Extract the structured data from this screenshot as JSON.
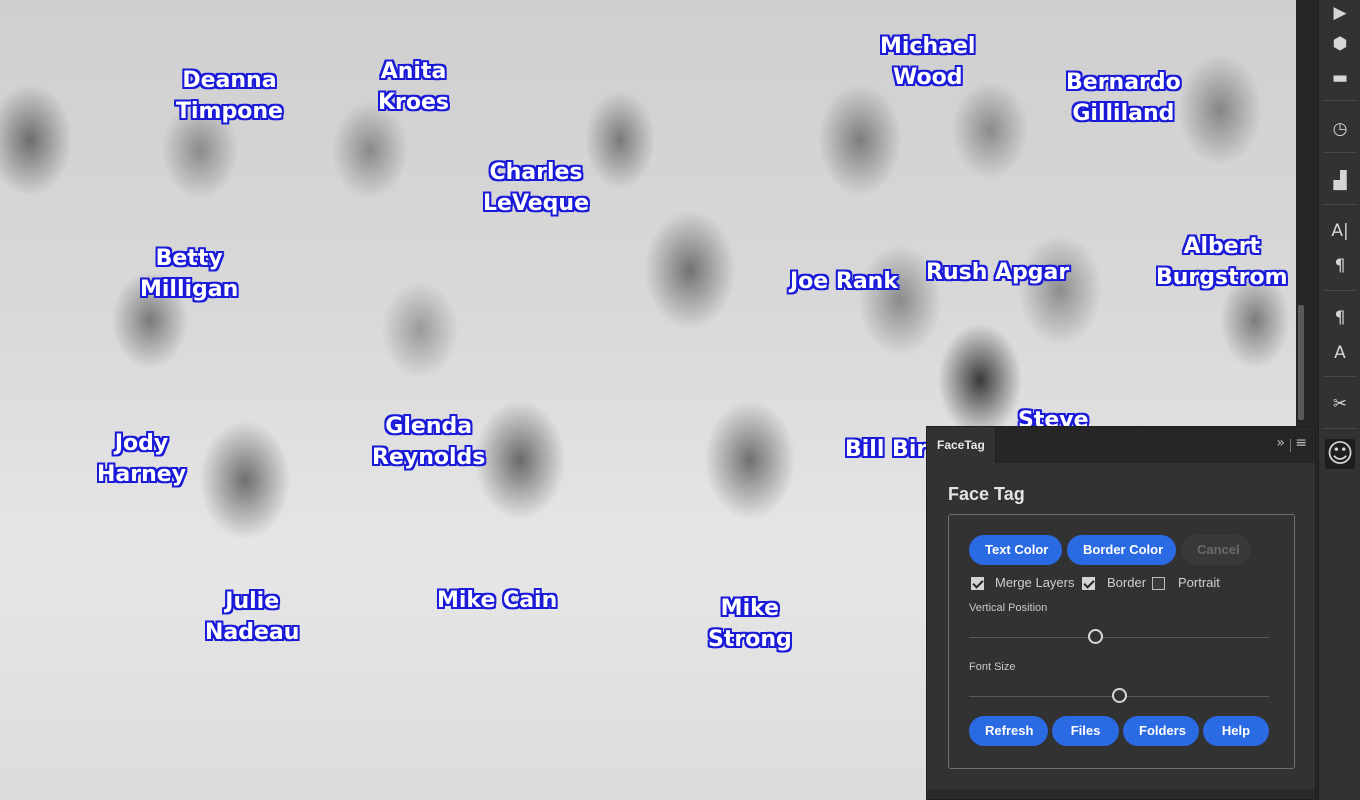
{
  "photo": {
    "tags": [
      {
        "id": "deanna",
        "lines": [
          "Deanna",
          "Timpone"
        ]
      },
      {
        "id": "anita",
        "lines": [
          "Anita",
          "Kroes"
        ]
      },
      {
        "id": "charles",
        "lines": [
          "Charles",
          "LeVeque"
        ]
      },
      {
        "id": "michael",
        "lines": [
          "Michael",
          "Wood"
        ]
      },
      {
        "id": "bernardo",
        "lines": [
          "Bernardo",
          "Gilliland"
        ]
      },
      {
        "id": "betty",
        "lines": [
          "Betty",
          "Milligan"
        ]
      },
      {
        "id": "joe",
        "lines": [
          "Joe Rank"
        ]
      },
      {
        "id": "rush",
        "lines": [
          "Rush Apgar"
        ]
      },
      {
        "id": "albert",
        "lines": [
          "Albert",
          "Burgstrom"
        ]
      },
      {
        "id": "glenda",
        "lines": [
          "Glenda",
          "Reynolds"
        ]
      },
      {
        "id": "jody",
        "lines": [
          "Jody",
          "Harney"
        ]
      },
      {
        "id": "bill",
        "lines": [
          "Bill Birt"
        ]
      },
      {
        "id": "steve",
        "lines": [
          "Steve"
        ]
      },
      {
        "id": "julie",
        "lines": [
          "Julie",
          "Nadeau"
        ]
      },
      {
        "id": "mikecain",
        "lines": [
          "Mike Cain"
        ]
      },
      {
        "id": "mikestrong",
        "lines": [
          "Mike",
          "Strong"
        ]
      }
    ]
  },
  "toolstrip": {
    "tools": [
      "play-icon",
      "plugin-icon",
      "comment-icon",
      "history-icon",
      "histogram-icon",
      "character-icon",
      "paragraph-icon",
      "paragraph-styles-icon",
      "character-styles-icon",
      "tools-icon",
      "facetag-smiley-icon"
    ],
    "glyphs": {
      "play": "▶",
      "plugin": "⬢",
      "comment": "▬",
      "history": "◷",
      "histogram": "▟",
      "character": "A|",
      "paragraph": "¶",
      "paragraph_styles": "¶",
      "character_styles": "A",
      "tools": "✂",
      "smiley": "☺"
    }
  },
  "panel": {
    "tab_label": "FaceTag",
    "collapse_glyph": "»",
    "menu_glyph": "≡",
    "title": "Face Tag",
    "buttons_top": {
      "text_color": "Text Color",
      "border_color": "Border Color",
      "cancel": "Cancel"
    },
    "options": [
      {
        "label": "Merge Layers",
        "checked": true
      },
      {
        "label": "Border",
        "checked": true
      },
      {
        "label": "Portrait",
        "checked": false
      }
    ],
    "vertical_position": {
      "label": "Vertical Position",
      "value_fraction": 0.42
    },
    "font_size": {
      "label": "Font Size",
      "value_fraction": 0.5
    },
    "buttons_bottom": {
      "refresh": "Refresh",
      "files": "Files",
      "folders": "Folders",
      "help": "Help"
    },
    "colors": {
      "accent": "#2a6ae2",
      "tag_outline": "#1a1ad8"
    }
  }
}
